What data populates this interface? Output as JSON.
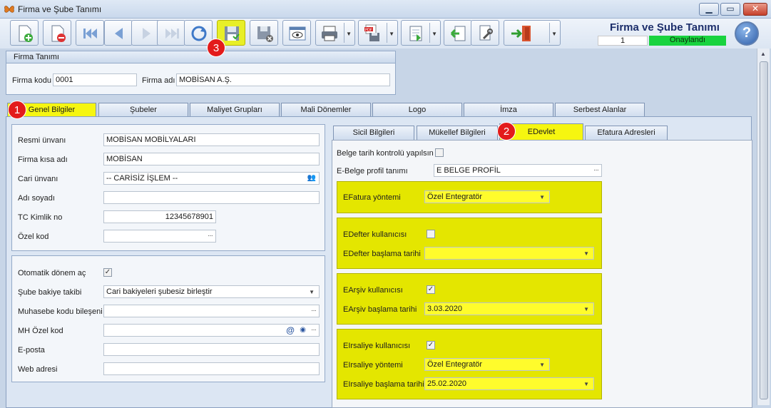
{
  "window": {
    "title": "Firma ve Şube Tanımı",
    "app_icon": "butterfly-icon"
  },
  "header": {
    "form_title": "Firma ve Şube Tanımı",
    "counter": "1",
    "status": "Onaylandı",
    "status_color": "#19d33f"
  },
  "toolbar": {
    "buttons": [
      "new-document-icon",
      "delete-document-icon",
      "first-record-icon",
      "previous-record-icon",
      "next-record-icon",
      "last-record-icon",
      "refresh-icon",
      "save-icon",
      "save-cancel-icon",
      "preview-icon",
      "print-icon",
      "pdf-export-icon",
      "export-icon",
      "import-icon",
      "tools-icon",
      "exit-icon",
      "help-icon"
    ]
  },
  "badges": {
    "b1": "1",
    "b2": "2",
    "b3": "3"
  },
  "firma": {
    "group_title": "Firma Tanımı",
    "kod_label": "Firma kodu",
    "kod_value": "0001",
    "adi_label": "Firma adı",
    "adi_value": "MOBİSAN A.Ş."
  },
  "tabs": [
    "Genel Bilgiler",
    "Şubeler",
    "Maliyet Grupları",
    "Mali Dönemler",
    "Logo",
    "İmza",
    "Serbest Alanlar"
  ],
  "general": {
    "resmi_unvan_label": "Resmi ünvanı",
    "resmi_unvan_value": "MOBİSAN MOBİLYALARI",
    "kisa_adi_label": "Firma kısa adı",
    "kisa_adi_value": "MOBİSAN",
    "cari_unvan_label": "Cari ünvanı",
    "cari_unvan_value": "-- CARİSİZ İŞLEM --",
    "adi_soyadi_label": "Adı soyadı",
    "adi_soyadi_value": "",
    "tc_label": "TC Kimlik no",
    "tc_value": "12345678901",
    "ozel_kod_label": "Özel kod",
    "ozel_kod_value": ""
  },
  "general2": {
    "otomatik_label": "Otomatik dönem aç",
    "sube_bakiye_label": "Şube bakiye takibi",
    "sube_bakiye_value": "Cari bakiyeleri şubesiz birleştir",
    "muhasebe_label": "Muhasebe kodu bileşeni",
    "muhasebe_value": "",
    "mh_ozel_label": "MH Özel kod",
    "mh_ozel_value": "",
    "eposta_label": "E-posta",
    "eposta_value": "",
    "web_label": "Web adresi",
    "web_value": ""
  },
  "subtabs": [
    "Sicil Bilgileri",
    "Mükellef Bilgileri",
    "EDevlet",
    "Efatura Adresleri"
  ],
  "edevlet": {
    "belge_tarih_label": "Belge tarih kontrolü yapılsın",
    "profil_label": "E-Belge profil tanımı",
    "profil_value": "E BELGE PROFİL",
    "efatura_yontem_label": "EFatura yöntemi",
    "efatura_yontem_value": "Özel Entegratör",
    "edefter_kullanici_label": "EDefter kullanıcısı",
    "edefter_tarih_label": "EDefter başlama tarihi",
    "edefter_tarih_value": "",
    "earsiv_kullanici_label": "EArşiv kullanıcısı",
    "earsiv_tarih_label": "EArşiv başlama tarihi",
    "earsiv_tarih_value": "3.03.2020",
    "eirsaliye_kullanici_label": "EIrsaliye kullanıcısı",
    "eirsaliye_yontem_label": "EIrsaliye yöntemi",
    "eirsaliye_yontem_value": "Özel Entegratör",
    "eirsaliye_tarih_label": "EIrsaliye başlama tarihi",
    "eirsaliye_tarih_value": "25.02.2020"
  }
}
